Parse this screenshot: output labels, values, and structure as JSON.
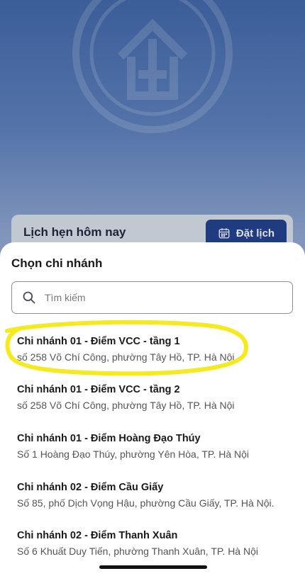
{
  "background": {
    "today_title": "Lịch hẹn hôm nay",
    "book_button_label": "Đặt lịch",
    "book_button_icon": "calendar-icon",
    "accent_color": "#1f3f8c"
  },
  "sheet": {
    "title": "Chọn chi nhánh",
    "search": {
      "placeholder": "Tìm kiếm",
      "value": "",
      "icon": "search-icon"
    },
    "branches": [
      {
        "name": "Chi nhánh 01 -  Điểm VCC  - tầng 1",
        "address": "số 258 Võ Chí Công, phường Tây Hồ, TP. Hà Nội"
      },
      {
        "name": "Chi nhánh 01 -  Điểm VCC  - tầng 2",
        "address": "số 258 Võ Chí Công, phường Tây Hồ, TP. Hà Nội"
      },
      {
        "name": "Chi nhánh 01 - Điểm Hoàng Đạo Thúy",
        "address": "Số 1 Hoàng Đạo Thúy, phường Yên Hòa, TP. Hà Nội"
      },
      {
        "name": "Chi nhánh 02 - Điểm Cầu Giấy",
        "address": "Số 85, phố Dịch Vọng Hậu, phường Cầu Giấy, TP. Hà Nội."
      },
      {
        "name": "Chi nhánh 02 - Điểm Thanh Xuân",
        "address": "Số 6 Khuất Duy Tiến, phường Thanh Xuân, TP. Hà Nội"
      }
    ],
    "highlight_color": "#f5ea1e"
  }
}
